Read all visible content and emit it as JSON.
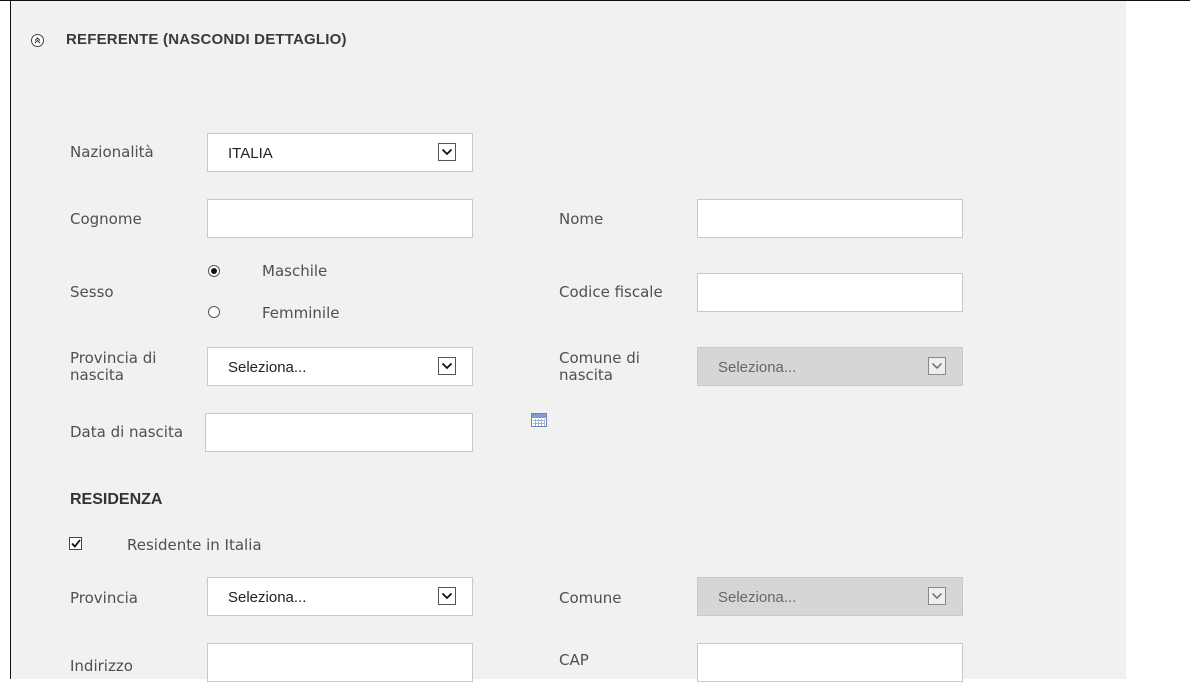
{
  "header": {
    "title": "REFERENTE (NASCONDI DETTAGLIO)",
    "icon": "chevron-double-up-icon"
  },
  "fields": {
    "nazionalita": {
      "label": "Nazionalità",
      "value": "ITALIA"
    },
    "cognome": {
      "label": "Cognome",
      "value": ""
    },
    "nome": {
      "label": "Nome",
      "value": ""
    },
    "sesso": {
      "label": "Sesso",
      "options": [
        "Maschile",
        "Femminile"
      ],
      "selected": "Maschile"
    },
    "codice_fiscale": {
      "label": "Codice fiscale",
      "value": ""
    },
    "provincia_nascita": {
      "label_line1": "Provincia di",
      "label_line2": "nascita",
      "value": "Seleziona..."
    },
    "comune_nascita": {
      "label_line1": "Comune di",
      "label_line2": "nascita",
      "value": "Seleziona...",
      "disabled": true
    },
    "data_nascita": {
      "label": "Data di nascita",
      "value": ""
    }
  },
  "residenza": {
    "title": "RESIDENZA",
    "residente_italia": {
      "label": "Residente in Italia",
      "checked": true
    },
    "provincia": {
      "label": "Provincia",
      "value": "Seleziona..."
    },
    "comune": {
      "label": "Comune",
      "value": "Seleziona...",
      "disabled": true
    },
    "indirizzo": {
      "label": "Indirizzo",
      "value": ""
    },
    "cap": {
      "label": "CAP",
      "value": ""
    }
  },
  "colors": {
    "panel_bg": "#f1f1f1",
    "disabled_select_bg": "#d6d6d6",
    "label_text": "#4f4f4f"
  }
}
